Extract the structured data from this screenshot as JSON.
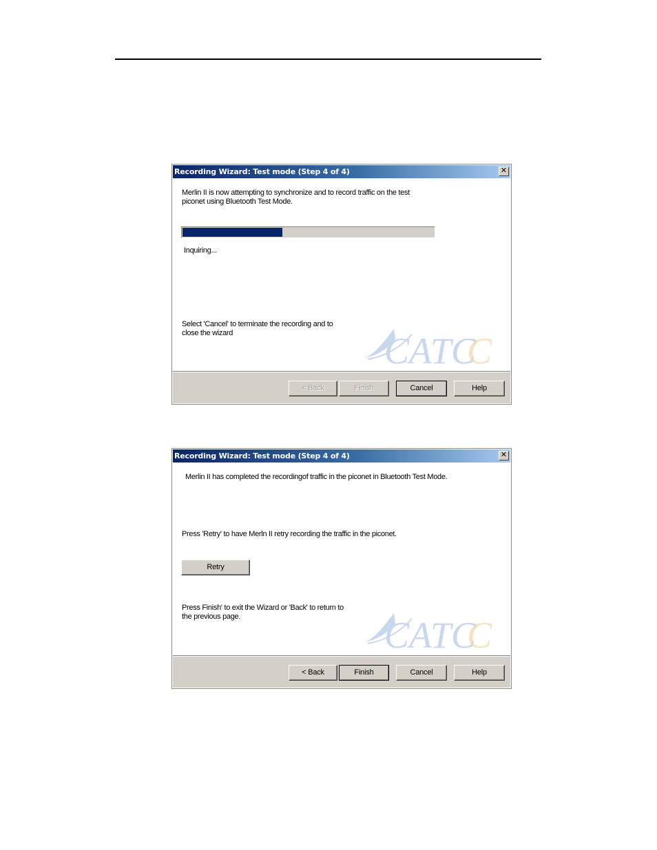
{
  "dialogs": [
    {
      "title": "Recording Wizard: Test mode (Step 4 of 4)",
      "close_glyph": "✕",
      "message_line1": "Merlin II  is now attempting to synchronize and to record traffic on the test",
      "message_line2": "piconet using Bluetooth Test Mode.",
      "progress_fraction": 0.4,
      "status": "Inquiring...",
      "hint_line1": "Select 'Cancel' to terminate the recording and to",
      "hint_line2": "close the wizard",
      "logo_text": "CATC",
      "buttons": {
        "back": "< Back",
        "finish": "Finish",
        "cancel": "Cancel",
        "help": "Help"
      }
    },
    {
      "title": "Recording Wizard: Test mode (Step 4 of 4)",
      "close_glyph": "✕",
      "message_line1": "Merlin II has completed the recordingof traffic in the piconet in Bluetooth Test Mode.",
      "retry_hint": "Press 'Retry' to have  Merln II  retry recording the traffic in the piconet.",
      "retry_label": "Retry",
      "hint_line1": "Press Finish' to exit the Wizard or 'Back' to return to",
      "hint_line2": "the previous page.",
      "logo_text": "CATC",
      "buttons": {
        "back": "< Back",
        "finish": "Finish",
        "cancel": "Cancel",
        "help": "Help"
      }
    }
  ],
  "colors": {
    "title_gradient_start": "#0a246a",
    "title_gradient_end": "#a6caf0",
    "progress_fill": "#0a246a",
    "face": "#d4d0c8",
    "logo_blue": "#c9d7ee",
    "logo_orange": "#f3d7a8"
  }
}
